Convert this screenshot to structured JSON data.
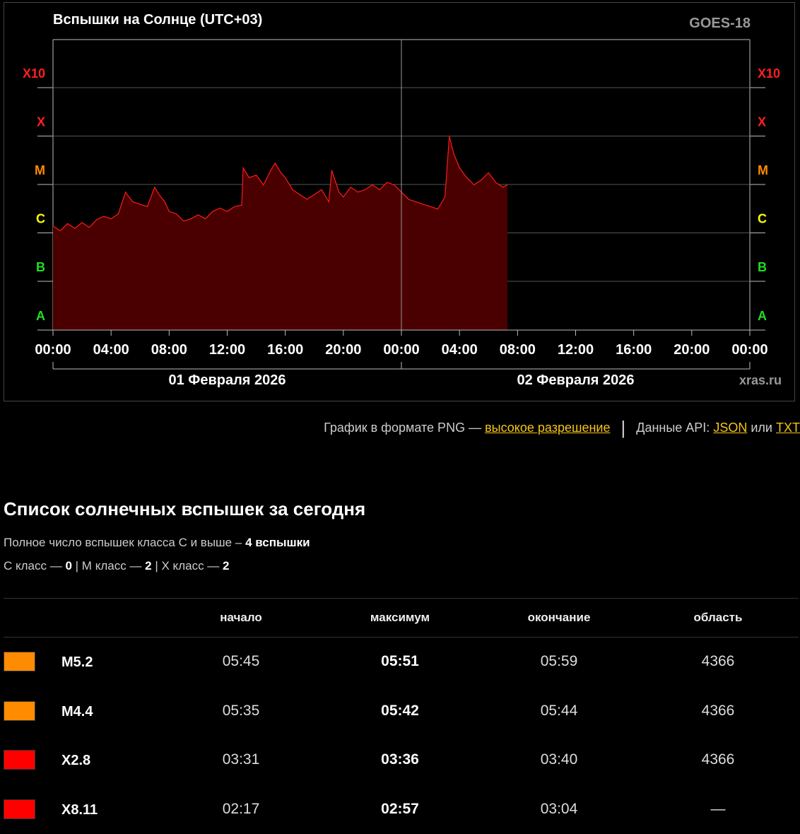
{
  "chart": {
    "title": "Вспышки на Солнце (UTC+03)",
    "satellite": "GOES-18",
    "credit": "xras.ru",
    "class_labels": [
      {
        "label": "X10",
        "color": "#ff2020"
      },
      {
        "label": "X",
        "color": "#ff2020"
      },
      {
        "label": "M",
        "color": "#ff8c00"
      },
      {
        "label": "C",
        "color": "#ffff00"
      },
      {
        "label": "B",
        "color": "#22dd22"
      },
      {
        "label": "A",
        "color": "#22dd22"
      }
    ],
    "time_labels": [
      "00:00",
      "04:00",
      "08:00",
      "12:00",
      "16:00",
      "20:00",
      "00:00",
      "04:00",
      "08:00",
      "12:00",
      "16:00",
      "20:00",
      "00:00"
    ],
    "date_labels": [
      "01 Февраля 2026",
      "02 Февраля 2026"
    ]
  },
  "chart_data": {
    "type": "area",
    "y_scale": "log",
    "ylabel_classes": [
      "A",
      "B",
      "C",
      "M",
      "X",
      "X10"
    ],
    "x_range_hours": [
      0,
      48
    ],
    "series": [
      {
        "fill": "#4a0000",
        "stroke": "#ff1a1a",
        "x_hours": [
          0,
          0.5,
          1,
          1.5,
          2,
          2.5,
          3,
          3.5,
          4,
          4.5,
          5,
          5.1,
          5.5,
          6,
          6.5,
          7,
          7.3,
          7.7,
          8,
          8.5,
          9,
          9.5,
          10,
          10.5,
          11,
          11.5,
          12,
          12.5,
          13,
          13.1,
          13.5,
          14,
          14.5,
          15,
          15.3,
          15.7,
          16,
          16.5,
          17,
          17.5,
          18,
          18.5,
          19,
          19.2,
          19.7,
          20,
          20.5,
          21,
          21.5,
          22,
          22.5,
          23,
          23.5,
          24,
          24.5,
          25,
          25.5,
          26,
          26.5,
          27,
          27.3,
          27.6,
          28,
          28.5,
          29,
          29.5,
          30,
          30.5,
          31,
          31.3
        ],
        "flux_log": [
          -5.85,
          -5.95,
          -5.8,
          -5.9,
          -5.78,
          -5.88,
          -5.72,
          -5.65,
          -5.7,
          -5.6,
          -5.15,
          -5.2,
          -5.35,
          -5.4,
          -5.45,
          -5.05,
          -5.2,
          -5.35,
          -5.55,
          -5.6,
          -5.75,
          -5.7,
          -5.62,
          -5.7,
          -5.55,
          -5.48,
          -5.55,
          -5.45,
          -5.42,
          -4.65,
          -4.85,
          -4.8,
          -5.0,
          -4.7,
          -4.55,
          -4.75,
          -4.85,
          -5.1,
          -5.2,
          -5.3,
          -5.2,
          -5.1,
          -5.35,
          -4.7,
          -5.15,
          -5.25,
          -5.05,
          -5.15,
          -5.1,
          -5.0,
          -5.1,
          -4.95,
          -5.0,
          -5.15,
          -5.3,
          -5.35,
          -5.4,
          -5.45,
          -5.5,
          -5.25,
          -4.0,
          -4.35,
          -4.65,
          -4.85,
          -5.0,
          -4.9,
          -4.75,
          -4.95,
          -5.05,
          -5.0
        ]
      }
    ],
    "grid": true
  },
  "links": {
    "png_prefix": "График в формате PNG —",
    "png_link": "высокое разрешение",
    "api_prefix": "Данные API:",
    "api_json": "JSON",
    "api_or": "или",
    "api_txt": "TXT"
  },
  "flares": {
    "heading": "Список солнечных вспышек за сегодня",
    "total_text": "Полное число вспышек класса C и выше –",
    "total_value": "4 вспышки",
    "c_label": "C класс —",
    "c_value": "0",
    "m_label": "| M класс —",
    "m_value": "2",
    "x_label": "| X класс —",
    "x_value": "2",
    "columns": [
      "начало",
      "максимум",
      "окончание",
      "область"
    ],
    "rows": [
      {
        "class": "M5.2",
        "color": "#ff8c00",
        "start": "05:45",
        "max": "05:51",
        "end": "05:59",
        "region": "4366"
      },
      {
        "class": "M4.4",
        "color": "#ff8c00",
        "start": "05:35",
        "max": "05:42",
        "end": "05:44",
        "region": "4366"
      },
      {
        "class": "X2.8",
        "color": "#ff0000",
        "start": "03:31",
        "max": "03:36",
        "end": "03:40",
        "region": "4366"
      },
      {
        "class": "X8.11",
        "color": "#ff0000",
        "start": "02:17",
        "max": "02:57",
        "end": "03:04",
        "region": "—"
      }
    ]
  }
}
